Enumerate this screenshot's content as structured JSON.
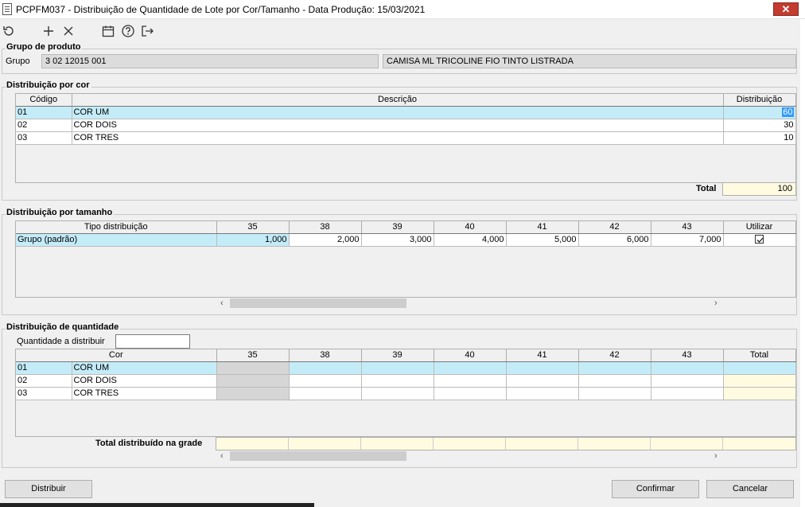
{
  "window": {
    "title": "PCPFM037 - Distribuição de Quantidade de Lote por Cor/Tamanho - Data Produção: 15/03/2021",
    "close": "✕"
  },
  "toolbar": {
    "icons": [
      "refresh-icon",
      "plus-icon",
      "close-x-icon",
      "calendar-icon",
      "help-icon",
      "exit-icon"
    ]
  },
  "grupo": {
    "legend": "Grupo de produto",
    "label": "Grupo",
    "code": "3 02 12015 001",
    "description": "CAMISA ML TRICOLINE FIO TINTO LISTRADA"
  },
  "cor": {
    "legend": "Distribuição por cor",
    "headers": {
      "codigo": "Código",
      "descricao": "Descrição",
      "distribuicao": "Distribuição"
    },
    "rows": [
      {
        "codigo": "01",
        "descricao": "COR UM",
        "distribuicao": "60"
      },
      {
        "codigo": "02",
        "descricao": "COR DOIS",
        "distribuicao": "30"
      },
      {
        "codigo": "03",
        "descricao": "COR TRES",
        "distribuicao": "10"
      }
    ],
    "total_label": "Total",
    "total": "100"
  },
  "tamanho": {
    "legend": "Distribuição por tamanho",
    "headers": [
      "Tipo distribuição",
      "35",
      "38",
      "39",
      "40",
      "41",
      "42",
      "43",
      "Utilizar"
    ],
    "row": {
      "tipo": "Grupo (padrão)",
      "values": [
        "1,000",
        "2,000",
        "3,000",
        "4,000",
        "5,000",
        "6,000",
        "7,000"
      ],
      "utilizar": true
    }
  },
  "quantidade": {
    "legend": "Distribuição de quantidade",
    "qty_label": "Quantidade a distribuir",
    "qty_value": "",
    "headers": [
      "Cor",
      "35",
      "38",
      "39",
      "40",
      "41",
      "42",
      "43",
      "Total"
    ],
    "rows": [
      {
        "codigo": "01",
        "cor": "COR UM"
      },
      {
        "codigo": "02",
        "cor": "COR DOIS"
      },
      {
        "codigo": "03",
        "cor": "COR TRES"
      }
    ],
    "total_label": "Total distribuído na grade"
  },
  "scroll": {
    "left": "‹",
    "right": "›"
  },
  "buttons": {
    "distribuir": "Distribuir",
    "confirmar": "Confirmar",
    "cancelar": "Cancelar"
  },
  "colors": {
    "selected_row": "#c4ecf8",
    "total_cell": "#fffbe1",
    "close_button": "#c43b2f"
  }
}
